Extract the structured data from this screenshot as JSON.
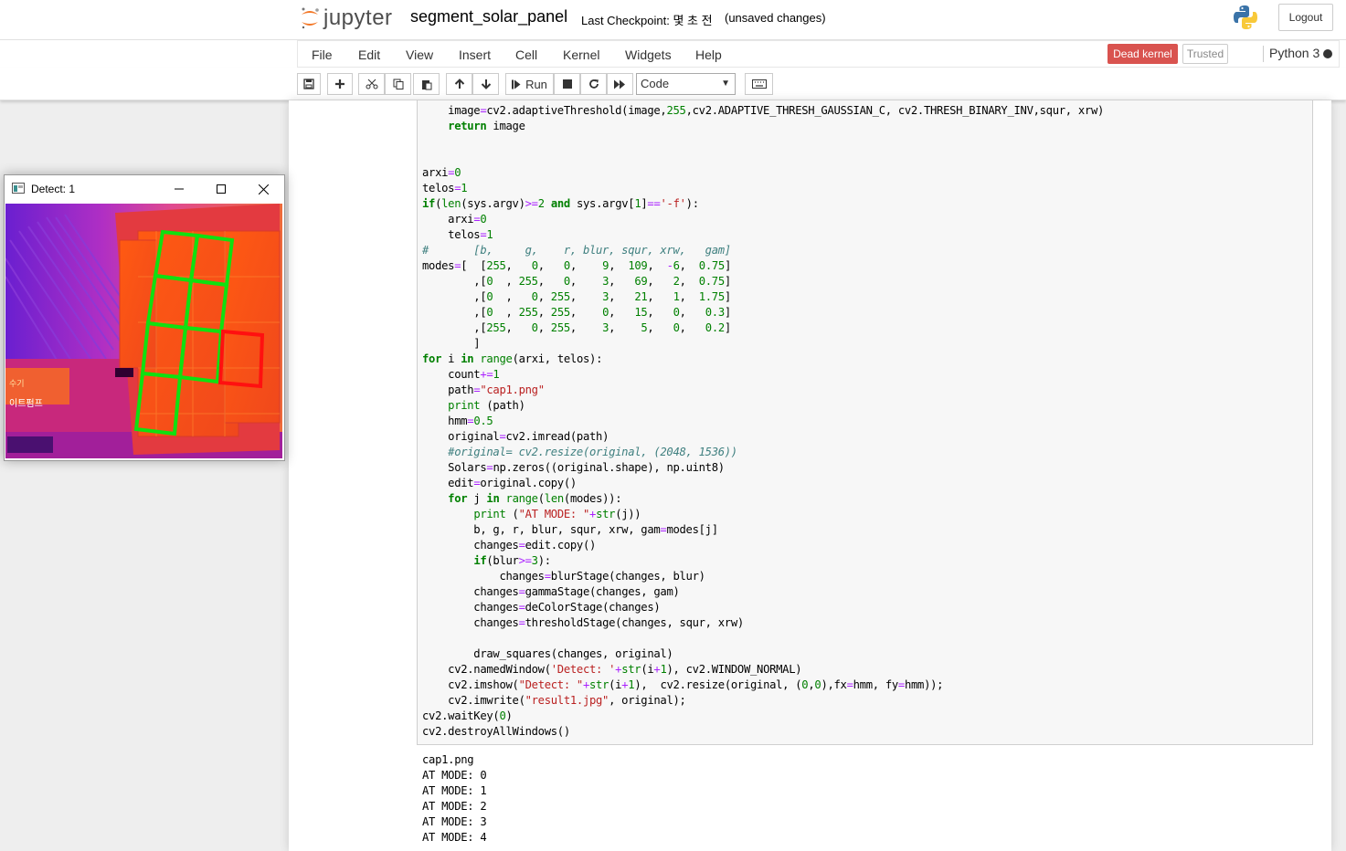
{
  "header": {
    "logo_text": "jupyter",
    "notebook_name": "segment_solar_panel",
    "checkpoint": "Last Checkpoint: 몇 초 전",
    "autosave": "(unsaved changes)",
    "logout_label": "Logout"
  },
  "menubar": {
    "items": [
      "File",
      "Edit",
      "View",
      "Insert",
      "Cell",
      "Kernel",
      "Widgets",
      "Help"
    ],
    "kernel_status": "Dead kernel",
    "trusted": "Trusted",
    "kernel_name": "Python 3"
  },
  "toolbar": {
    "run_label": "Run",
    "cell_type": "Code",
    "icons": [
      "save-icon",
      "plus-icon",
      "cut-icon",
      "copy-icon",
      "paste-icon",
      "arrow-up-icon",
      "arrow-down-icon",
      "step-forward-icon",
      "stop-icon",
      "restart-icon",
      "fast-forward-icon",
      "keyboard-icon"
    ]
  },
  "code_lines": [
    "    image=cv2.adaptiveThreshold(image,255,cv2.ADAPTIVE_THRESH_GAUSSIAN_C, cv2.THRESH_BINARY_INV,squr, xrw)",
    "    return image",
    "",
    "",
    "arxi=0",
    "telos=1",
    "if(len(sys.argv)>=2 and sys.argv[1]=='-f'):",
    "    arxi=0",
    "    telos=1",
    "#       [b,     g,    r, blur, squr, xrw,   gam]",
    "modes=[  [255,   0,   0,    9,  109,  -6,  0.75]",
    "        ,[0  , 255,   0,    3,   69,   2,  0.75]",
    "        ,[0  ,   0, 255,    3,   21,   1,  1.75]",
    "        ,[0  , 255, 255,    0,   15,   0,   0.3]",
    "        ,[255,   0, 255,    3,    5,   0,   0.2]",
    "        ]",
    "for i in range(arxi, telos):",
    "    count+=1",
    "    path=\"cap1.png\"",
    "    print (path)",
    "    hmm=0.5",
    "    original=cv2.imread(path)",
    "    #original= cv2.resize(original, (2048, 1536))",
    "    Solars=np.zeros((original.shape), np.uint8)",
    "    edit=original.copy()",
    "    for j in range(len(modes)):",
    "        print (\"AT MODE: \"+str(j))",
    "        b, g, r, blur, squr, xrw, gam=modes[j]",
    "        changes=edit.copy()",
    "        if(blur>=3):",
    "            changes=blurStage(changes, blur)",
    "        changes=gammaStage(changes, gam)",
    "        changes=deColorStage(changes)",
    "        changes=thresholdStage(changes, squr, xrw)",
    "",
    "        draw_squares(changes, original)",
    "    cv2.namedWindow('Detect: '+str(i+1), cv2.WINDOW_NORMAL)",
    "    cv2.imshow(\"Detect: \"+str(i+1),  cv2.resize(original, (0,0),fx=hmm, fy=hmm));",
    "    cv2.imwrite(\"result1.jpg\", original);",
    "cv2.waitKey(0)",
    "cv2.destroyAllWindows()"
  ],
  "output_lines": [
    "cap1.png",
    "AT MODE: 0",
    "AT MODE: 1",
    "AT MODE: 2",
    "AT MODE: 3",
    "AT MODE: 4"
  ],
  "detect_window": {
    "title": "Detect: 1",
    "image_text": [
      "수기",
      "이트펌프"
    ]
  }
}
